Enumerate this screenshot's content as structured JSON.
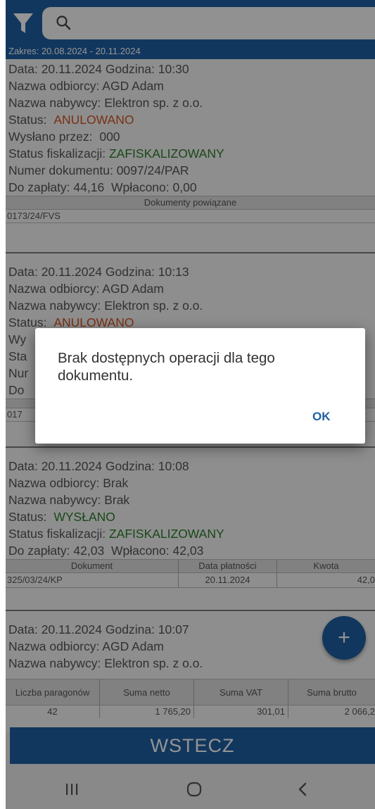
{
  "range_text": "Zakres: 20.08.2024 - 20.11.2024",
  "labels": {
    "date": "Data:",
    "time": "Godzina:",
    "recipient": "Nazwa odbiorcy:",
    "buyer": "Nazwa nabywcy:",
    "status": "Status:",
    "sent_by": "Wysłano przez:",
    "fiscal": "Status fiskalizacji:",
    "doc_number": "Numer dokumentu:",
    "to_pay": "Do zapłaty:",
    "paid": "Wpłacono:"
  },
  "cards": [
    {
      "date": "20.11.2024",
      "time": "10:30",
      "recipient": "AGD Adam",
      "buyer": "Elektron sp. z o.o.",
      "status": "ANULOWANO",
      "sent_by": "000",
      "fiscal": "ZAFISKALIZOWANY",
      "doc_number": "0097/24/PAR",
      "to_pay": "44,16",
      "paid": "0,00",
      "related_header": "Dokumenty powiązane",
      "related": "0173/24/FVS"
    },
    {
      "date": "20.11.2024",
      "time": "10:13",
      "recipient": "AGD Adam",
      "buyer": "Elektron sp. z o.o.",
      "status": "ANULOWANO",
      "hidden_sent": "Wy",
      "hidden_fiscal": "Sta",
      "hidden_doc": "Nur",
      "hidden_pay": "Do",
      "related": "017"
    },
    {
      "date": "20.11.2024",
      "time": "10:08",
      "recipient": "Brak",
      "buyer": "Brak",
      "status": "WYSŁANO",
      "fiscal": "ZAFISKALIZOWANY",
      "to_pay": "42,03",
      "paid": "42,03",
      "payments_headers": [
        "Dokument",
        "Data płatności",
        "Kwota"
      ],
      "payments_row": [
        "325/03/24/KP",
        "20.11.2024",
        "42,0"
      ]
    },
    {
      "date": "20.11.2024",
      "time": "10:07",
      "recipient": "AGD Adam",
      "buyer": "Elektron sp. z o.o."
    }
  ],
  "summary": {
    "headers": [
      "Liczba paragonów",
      "Suma netto",
      "Suma VAT",
      "Suma brutto"
    ],
    "values": [
      "42",
      "1 765,20",
      "301,01",
      "2 066,2"
    ]
  },
  "fab_label": "+",
  "back_button": "WSTECZ",
  "dialog": {
    "message": "Brak dostępnych operacji dla tego dokumentu.",
    "ok": "OK"
  }
}
